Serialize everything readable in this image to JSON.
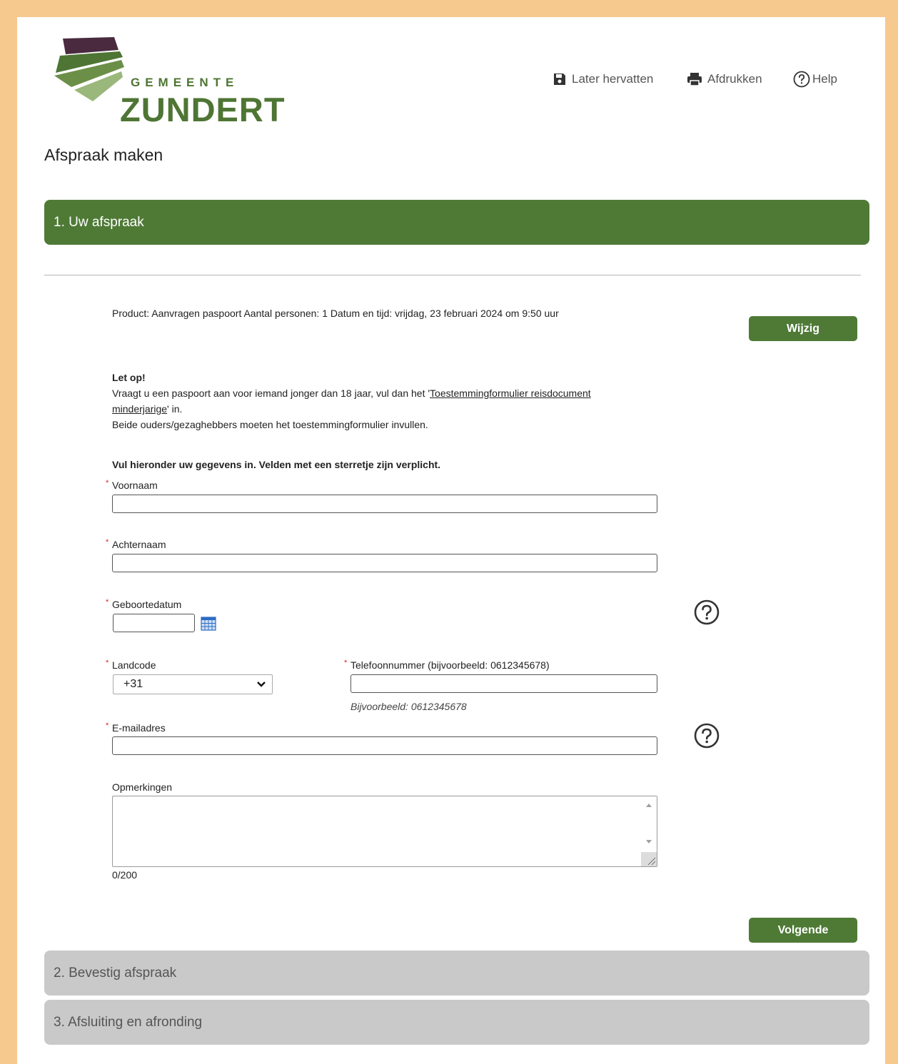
{
  "header": {
    "logo_top": "GEMEENTE",
    "logo_main": "ZUNDERT",
    "links": {
      "resume": "Later hervatten",
      "print": "Afdrukken",
      "help": "Help"
    }
  },
  "page_title": "Afspraak maken",
  "steps": {
    "step1": "1. Uw afspraak",
    "step2": "2. Bevestig afspraak",
    "step3": "3. Afsluiting en afronding"
  },
  "summary": "Product: Aanvragen paspoort Aantal personen: 1 Datum en tijd: vrijdag, 23 februari 2024 om 9:50 uur",
  "buttons": {
    "change": "Wijzig",
    "next": "Volgende"
  },
  "notice": {
    "title": "Let op!",
    "line1_pre": "Vraagt u een paspoort aan voor iemand jonger dan 18 jaar, vul dan het '",
    "link_part1": "Toestemmingformulier reisdocument",
    "link_part2": "minderjarige",
    "line2_post": "' in.",
    "line3": "Beide ouders/gezaghebbers moeten het toestemmingformulier invullen."
  },
  "form": {
    "intro": "Vul hieronder uw gegevens in. Velden met een sterretje zijn verplicht.",
    "required_marker": "*",
    "firstname_label": "Voornaam",
    "firstname_value": "",
    "lastname_label": "Achternaam",
    "lastname_value": "",
    "birthdate_label": "Geboortedatum",
    "birthdate_value": "",
    "countrycode_label": "Landcode",
    "countrycode_value": "+31",
    "phone_label": "Telefoonnummer (bijvoorbeeld: 0612345678)",
    "phone_value": "",
    "phone_hint": "Bijvoorbeeld: 0612345678",
    "email_label": "E-mailadres",
    "email_value": "",
    "remarks_label": "Opmerkingen",
    "remarks_counter": "0/200"
  },
  "colors": {
    "green": "#4e7a36",
    "frame": "#f6c98f",
    "inactive_step": "#c9c9c9",
    "required": "#d9261c"
  },
  "icons": {
    "resume": "save-icon",
    "print": "printer-icon",
    "help": "question-circle-icon",
    "calendar": "calendar-icon",
    "select": "chevron-down-icon"
  }
}
